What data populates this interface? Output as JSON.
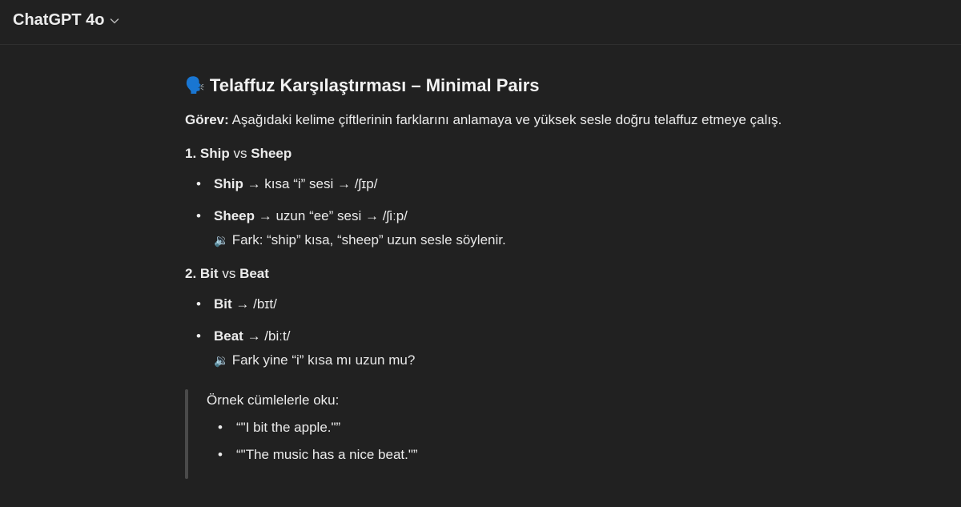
{
  "header": {
    "model_name": "ChatGPT 4o",
    "chevron_icon": "chevron-down-icon"
  },
  "message": {
    "title_emoji": "🗣️",
    "title": "Telaffuz Karşılaştırması – Minimal Pairs",
    "task_label": "Görev:",
    "task_text": " Aşağıdaki kelime çiftlerinin farklarını anlamaya ve yüksek sesle doğru telaffuz etmeye çalış.",
    "sections": [
      {
        "number": "1.",
        "word_a": "Ship",
        "vs": "vs",
        "word_b": "Sheep",
        "items": [
          {
            "word": "Ship",
            "text": " → kısa “i” sesi → /ʃɪp/"
          },
          {
            "word": "Sheep",
            "text": " → uzun “ee” sesi → /ʃiːp/"
          }
        ],
        "note_icon": "🔉",
        "note": "Fark: “ship” kısa, “sheep” uzun sesle söylenir."
      },
      {
        "number": "2.",
        "word_a": "Bit",
        "vs": "vs",
        "word_b": "Beat",
        "items": [
          {
            "word": "Bit",
            "text": " → /bɪt/"
          },
          {
            "word": "Beat",
            "text": " → /biːt/"
          }
        ],
        "note_icon": "🔉",
        "note": "Fark yine “i” kısa mı uzun mu?"
      }
    ],
    "quote": {
      "title": "Örnek cümlelerle oku:",
      "items": [
        "“\"I bit the apple.\"”",
        "“\"The music has a nice beat.\"”"
      ]
    }
  },
  "colors": {
    "background": "#212121",
    "text": "#ececec",
    "quote_bar": "#4a4a4a"
  }
}
